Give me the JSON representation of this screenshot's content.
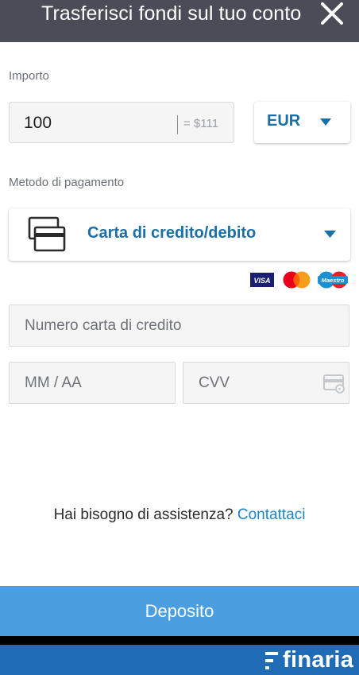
{
  "header": {
    "title": "Trasferisci fondi sul tuo conto",
    "close_icon": "close-icon"
  },
  "amount": {
    "label": "Importo",
    "value": "100",
    "conversion": "= $111"
  },
  "currency": {
    "selected": "EUR",
    "icon": "chevron-down-icon"
  },
  "payment": {
    "label": "Metodo di pagamento",
    "method": "Carta di credito/debito",
    "method_icon": "credit-card-icon",
    "brands": [
      "VISA",
      "Mastercard",
      "Maestro"
    ],
    "brand_colors": {
      "visa": "#1a1f71",
      "mastercard_red": "#eb001b",
      "mastercard_orange": "#f79e1b",
      "maestro": "#1a8fd6"
    }
  },
  "card": {
    "number_placeholder": "Numero carta di credito",
    "expiry_placeholder": "MM / AA",
    "cvv_placeholder": "CVV",
    "cvv_icon": "card-back-icon"
  },
  "help": {
    "text": "Hai bisogno di assistenza?",
    "link": "Contattaci"
  },
  "deposit_button": "Deposito",
  "footer": {
    "brand": "finaria"
  },
  "colors": {
    "header_bg": "#4a4d57",
    "accent": "#1c6fa6",
    "link": "#1c85c8",
    "button": "#4b9fe0",
    "footer": "#1f6bb5"
  }
}
